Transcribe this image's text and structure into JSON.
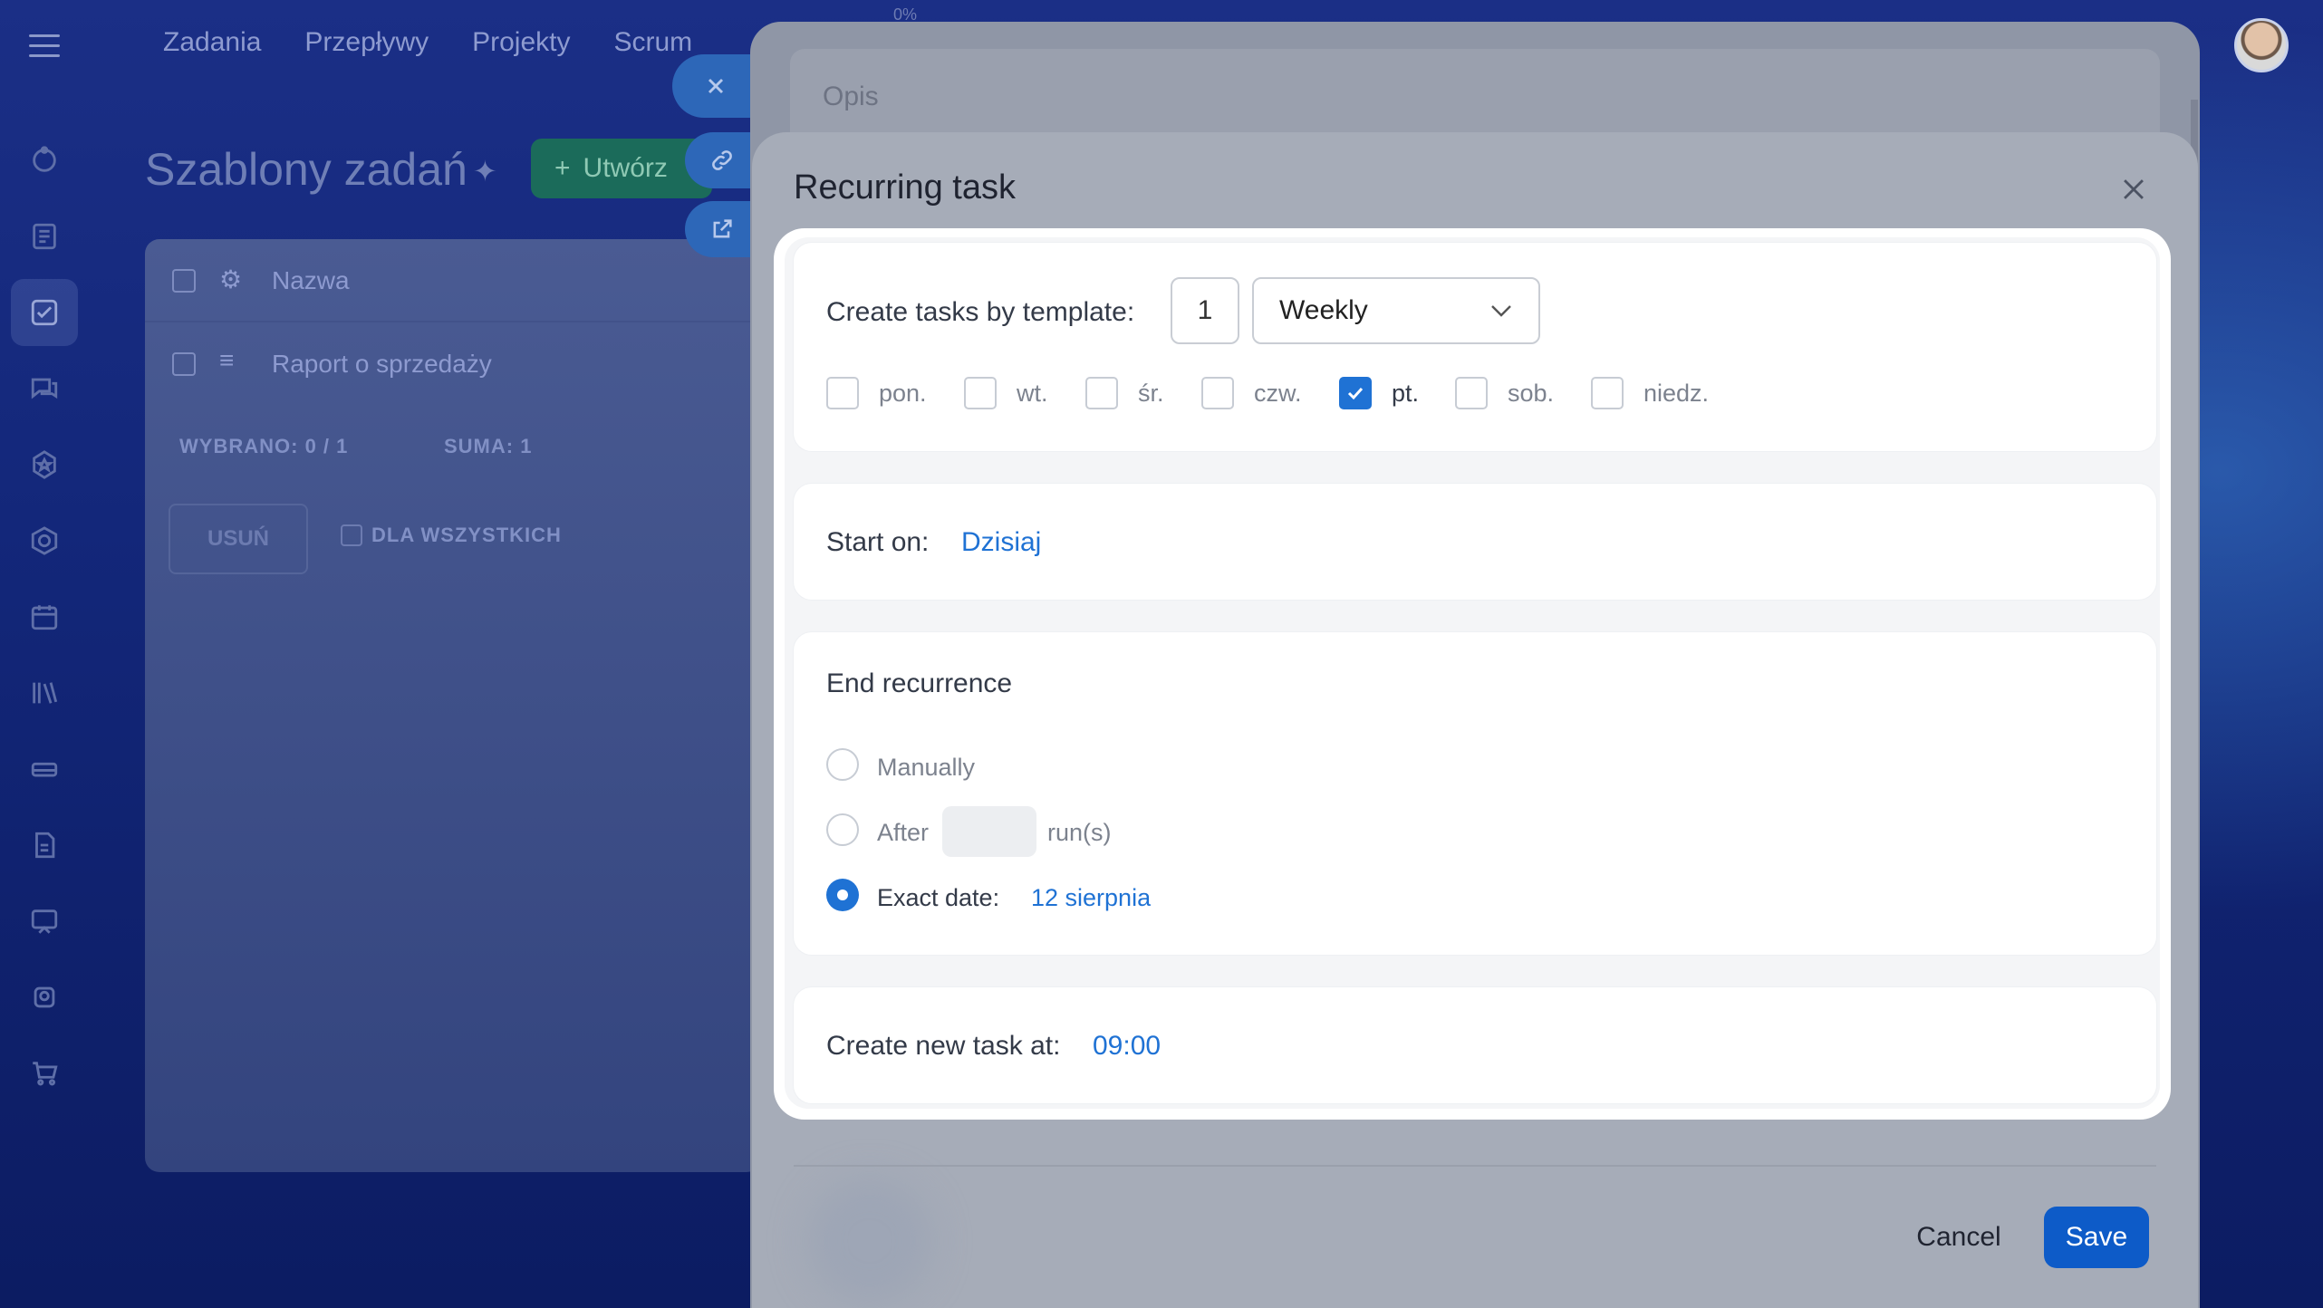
{
  "top_nav": {
    "items": [
      "Zadania",
      "Przepływy",
      "Projekty",
      "Scrum"
    ],
    "progress": "0%"
  },
  "page": {
    "title": "Szablony zadań",
    "create_label": "Utwórz"
  },
  "table": {
    "header_name": "Nazwa",
    "rows": [
      {
        "name": "Raport o sprzedaży"
      }
    ],
    "selected_label": "WYBRANO:",
    "selected_value": "0 / 1",
    "sum_label": "SUMA:",
    "sum_value": "1",
    "delete_label": "USUŃ",
    "for_all_label": "DLA WSZYSTKICH"
  },
  "background_panel": {
    "description_placeholder": "Opis"
  },
  "modal": {
    "title": "Recurring task",
    "template_label": "Create tasks by template:",
    "interval": "1",
    "frequency": "Weekly",
    "days": [
      {
        "label": "pon.",
        "checked": false
      },
      {
        "label": "wt.",
        "checked": false
      },
      {
        "label": "śr.",
        "checked": false
      },
      {
        "label": "czw.",
        "checked": false
      },
      {
        "label": "pt.",
        "checked": true
      },
      {
        "label": "sob.",
        "checked": false
      },
      {
        "label": "niedz.",
        "checked": false
      }
    ],
    "start_label": "Start on:",
    "start_value": "Dzisiaj",
    "end_title": "End recurrence",
    "end_options": {
      "manually": "Manually",
      "after": "After",
      "runs": "run(s)",
      "exact": "Exact date:",
      "exact_value": "12 sierpnia",
      "selected": "exact"
    },
    "time_label": "Create new task at:",
    "time_value": "09:00",
    "cancel_label": "Cancel",
    "save_label": "Save"
  },
  "colors": {
    "accent": "#1f72d4",
    "save": "#0d5bc8",
    "background": "#13277a"
  }
}
